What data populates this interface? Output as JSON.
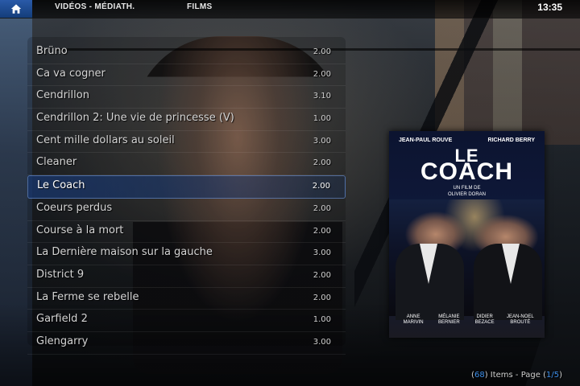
{
  "header": {
    "breadcrumb_1": "VIDÉOS - MÉDIATH.",
    "breadcrumb_2": "FILMS",
    "clock": "13:35"
  },
  "list": {
    "items": [
      {
        "title": "Brüno",
        "rating": "2.00"
      },
      {
        "title": "Ca va cogner",
        "rating": "2.00"
      },
      {
        "title": "Cendrillon",
        "rating": "3.10"
      },
      {
        "title": "Cendrillon 2: Une vie de princesse (V)",
        "rating": "1.00"
      },
      {
        "title": "Cent mille dollars au soleil",
        "rating": "3.00"
      },
      {
        "title": "Cleaner",
        "rating": "2.00"
      },
      {
        "title": "Le Coach",
        "rating": "2.00",
        "selected": true
      },
      {
        "title": "Coeurs perdus",
        "rating": "2.00"
      },
      {
        "title": "Course à la mort",
        "rating": "2.00"
      },
      {
        "title": "La Dernière maison sur la gauche",
        "rating": "3.00"
      },
      {
        "title": "District 9",
        "rating": "2.00"
      },
      {
        "title": "La Ferme se rebelle",
        "rating": "2.00"
      },
      {
        "title": "Garfield 2",
        "rating": "1.00"
      },
      {
        "title": "Glengarry",
        "rating": "3.00"
      }
    ]
  },
  "poster": {
    "actor_left": "JEAN-PAUL ROUVE",
    "actor_right": "RICHARD BERRY",
    "title_line1": "LE",
    "title_line2": "COACH",
    "director_line1": "UN FILM DE",
    "director_line2": "OLIVIER DORAN",
    "credits": [
      {
        "line1": "ANNE",
        "line2": "MARIVIN"
      },
      {
        "line1": "MÉLANIE",
        "line2": "BERNIER"
      },
      {
        "line1": "DIDIER",
        "line2": "BEZACE"
      },
      {
        "line1": "JEAN-NOEL",
        "line2": "BROUTÉ"
      }
    ]
  },
  "footer": {
    "open_paren": "(",
    "item_count": "68",
    "items_label": ") Items - Page (",
    "page": "1/5",
    "close_paren": ")"
  },
  "colors": {
    "accent": "#3d8ee8",
    "selection": "#19376e",
    "home_button": "#2a5aa8"
  },
  "icons": {
    "home": "home-icon"
  }
}
